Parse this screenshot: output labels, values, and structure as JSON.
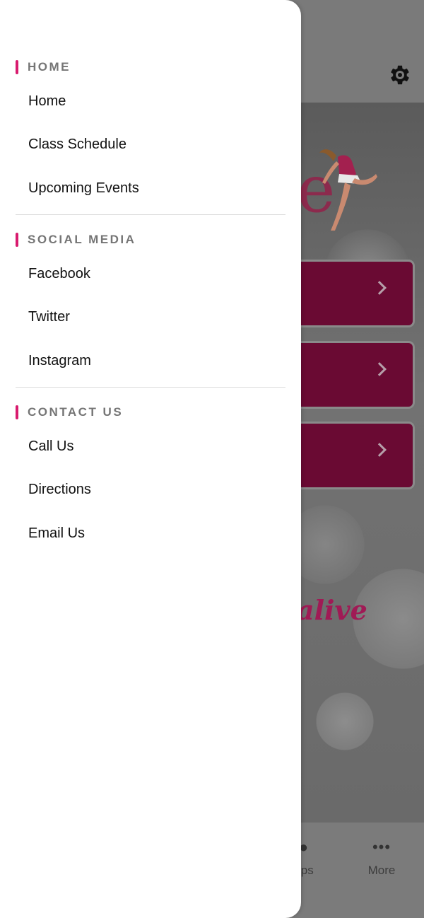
{
  "drawer": {
    "sections": [
      {
        "title": "HOME",
        "items": [
          "Home",
          "Class Schedule",
          "Upcoming Events"
        ]
      },
      {
        "title": "SOCIAL MEDIA",
        "items": [
          "Facebook",
          "Twitter",
          "Instagram"
        ]
      },
      {
        "title": "CONTACT US",
        "items": [
          "Call Us",
          "Directions",
          "Email Us"
        ]
      }
    ]
  },
  "background": {
    "logo_letter": "e",
    "tagline": "alive",
    "tabs": [
      {
        "label": "ups",
        "icon": "people-icon"
      },
      {
        "label": "More",
        "icon": "more-dots-icon"
      }
    ],
    "colors": {
      "accent": "#d81b6e",
      "button": "#6a0a33"
    }
  }
}
